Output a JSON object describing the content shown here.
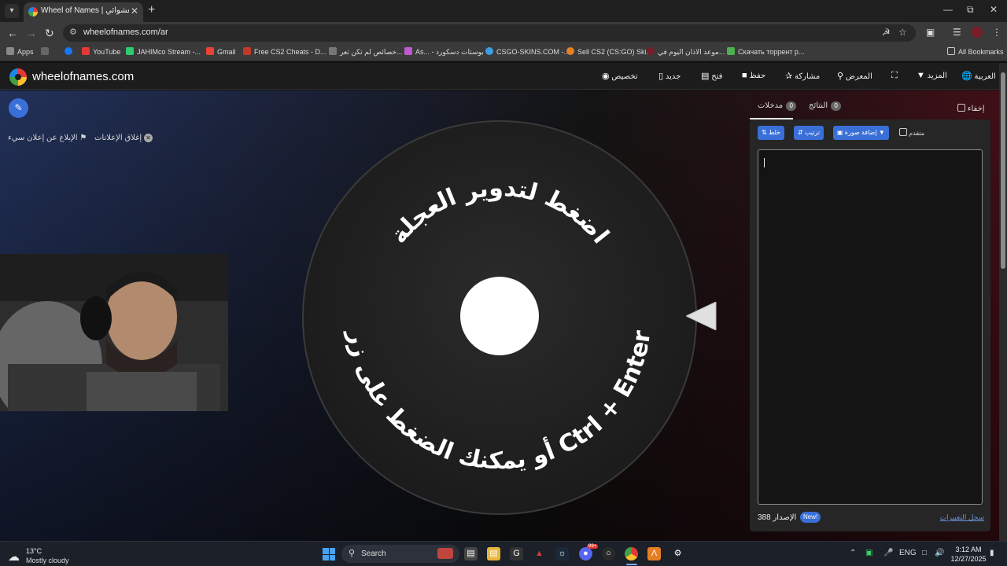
{
  "browser": {
    "tab_title": "Wheel of Names | عجلة الاسم العشوائي",
    "url": "wheelofnames.com/ar",
    "bookmarks": [
      {
        "label": "Apps",
        "color": "#888888"
      },
      {
        "label": "YouTube",
        "color": "#e53935"
      },
      {
        "label": "JAHIMco Stream -...",
        "color": "#2ecc71"
      },
      {
        "label": "Gmail",
        "color": "#ea4335"
      },
      {
        "label": "Free CS2 Cheats - D...",
        "color": "#c0392b"
      },
      {
        "label": "خصائص لم تكن تعر...",
        "color": "#777777"
      },
      {
        "label": "As... - بوستات دسكورد",
        "color": "#c05ad0"
      },
      {
        "label": "CSGO-SKINS.COM -...",
        "color": "#3aa0e0"
      },
      {
        "label": "Sell CS2 (CS:GO) Ski...",
        "color": "#e67e22"
      },
      {
        "label": "موعد الاذان اليوم في...",
        "color": "#7a1c2a"
      },
      {
        "label": "Скачать торрент р...",
        "color": "#4caf50"
      }
    ],
    "all_bookmarks": "All Bookmarks"
  },
  "site": {
    "brand": "wheelofnames.com",
    "nav": {
      "language": "العربية",
      "more": "المزيد",
      "gallery": "المعرض",
      "share": "مشاركة",
      "save": "حفظ",
      "open": "فتح",
      "new": "جديد",
      "customize": "تخصيص"
    },
    "ads": {
      "close_ads": "إغلاق الإعلانات",
      "report_ad": "الإبلاغ عن إعلان سيء"
    },
    "wheel": {
      "top_text": "اضغط لتدوير العجلة",
      "bottom_text": "أو يمكنك الضغط على زر Ctrl + Enter"
    },
    "panel": {
      "hide": "إخفاء",
      "tab_entries": "مدخلات",
      "entries_count": "0",
      "tab_results": "النتائج",
      "results_count": "0",
      "shuffle": "خلط",
      "sort": "ترتيب",
      "add_image": "إضافة صورة",
      "advanced": "متقدم",
      "version_label": "الإصدار",
      "version_number": "388",
      "new_badge": "New!",
      "changelog": "سجل التغييرات"
    }
  },
  "taskbar": {
    "temperature": "13°C",
    "condition": "Mostly cloudy",
    "search": "Search",
    "lang": "ENG",
    "time": "3:12 AM",
    "date": "12/27/2025",
    "notification_badge": "99+"
  }
}
